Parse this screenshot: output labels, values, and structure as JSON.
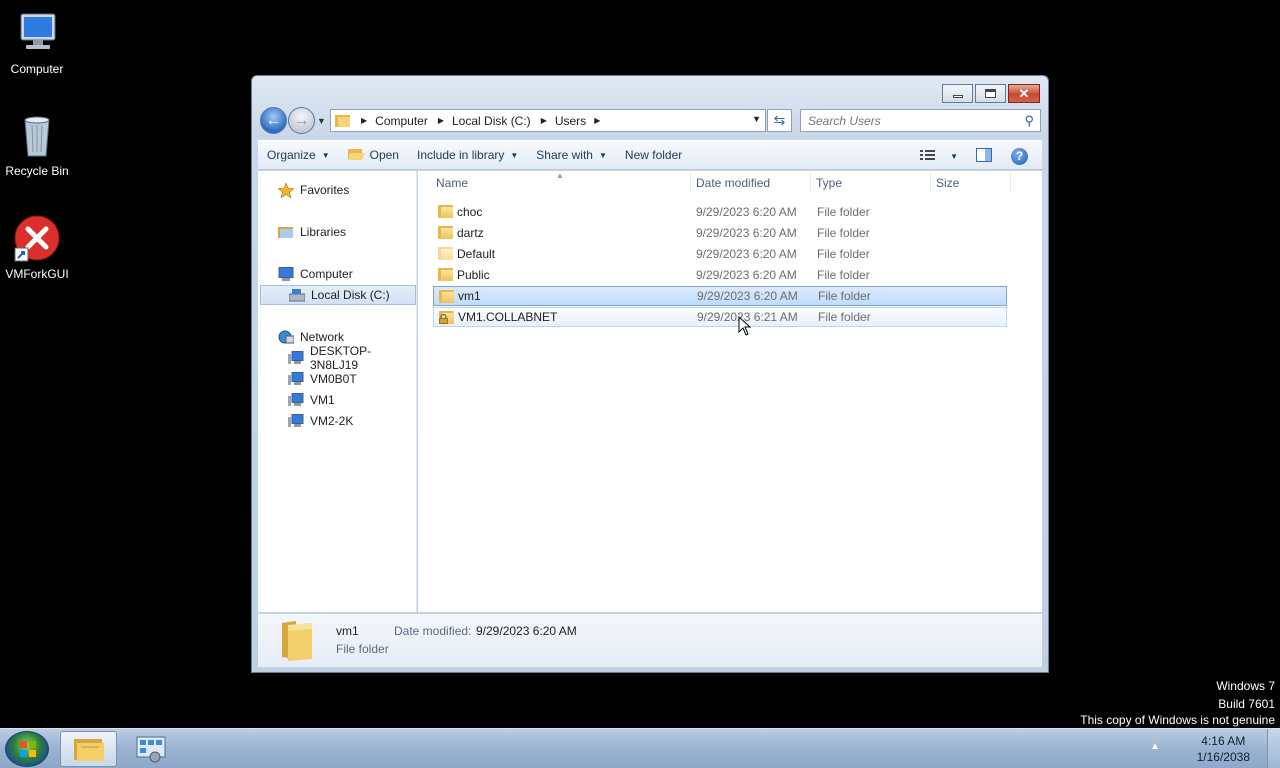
{
  "desktop": {
    "icons": [
      {
        "label": "Computer"
      },
      {
        "label": "Recycle Bin"
      },
      {
        "label": "VMForkGUI"
      }
    ]
  },
  "window": {
    "address": {
      "crumbs": [
        "Computer",
        "Local Disk (C:)",
        "Users"
      ]
    },
    "search": {
      "placeholder": "Search Users"
    },
    "toolbar": {
      "organize": "Organize",
      "open": "Open",
      "include_in_library": "Include in library",
      "share_with": "Share with",
      "new_folder": "New folder"
    },
    "nav": {
      "favorites": "Favorites",
      "libraries": "Libraries",
      "computer": "Computer",
      "local_disk": "Local Disk (C:)",
      "network": "Network",
      "network_items": [
        "DESKTOP-3N8LJ19",
        "VM0B0T",
        "VM1",
        "VM2-2K"
      ]
    },
    "columns": {
      "name": "Name",
      "date_modified": "Date modified",
      "type": "Type",
      "size": "Size"
    },
    "files": [
      {
        "name": "choc",
        "date": "9/29/2023 6:20 AM",
        "type": "File folder"
      },
      {
        "name": "dartz",
        "date": "9/29/2023 6:20 AM",
        "type": "File folder"
      },
      {
        "name": "Default",
        "date": "9/29/2023 6:20 AM",
        "type": "File folder"
      },
      {
        "name": "Public",
        "date": "9/29/2023 6:20 AM",
        "type": "File folder"
      },
      {
        "name": "vm1",
        "date": "9/29/2023 6:20 AM",
        "type": "File folder"
      },
      {
        "name": "VM1.COLLABNET",
        "date": "9/29/2023 6:21 AM",
        "type": "File folder"
      }
    ],
    "selected_index": 4,
    "hover_index": 5,
    "details": {
      "name": "vm1",
      "date_label": "Date modified:",
      "date_value": "9/29/2023 6:20 AM",
      "type": "File folder"
    }
  },
  "watermark": {
    "line1": "Windows 7",
    "line2": "Build 7601",
    "line3": "This copy of Windows is not genuine"
  },
  "taskbar": {
    "time": "4:16 AM",
    "date": "1/16/2038"
  },
  "colors": {
    "selection": "#c1dbfc",
    "selection_border": "#7da2ce",
    "folder": "#eec35c"
  }
}
